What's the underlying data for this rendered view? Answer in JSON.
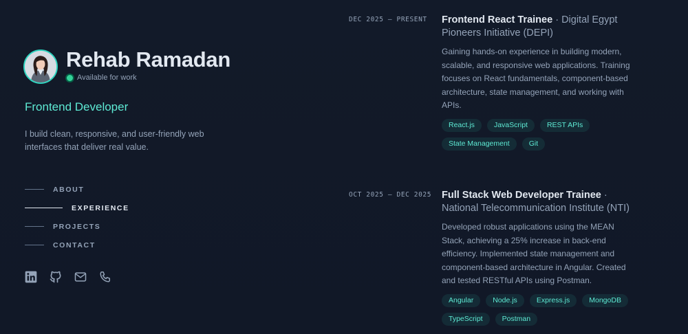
{
  "profile": {
    "name": "Rehab Ramadan",
    "availability": "Available for work",
    "role": "Frontend Developer",
    "tagline": "I build clean, responsive, and user-friendly web interfaces that deliver real value."
  },
  "nav": {
    "items": [
      {
        "label": "ABOUT",
        "active": false
      },
      {
        "label": "EXPERIENCE",
        "active": true
      },
      {
        "label": "PROJECTS",
        "active": false
      },
      {
        "label": "CONTACT",
        "active": false
      }
    ]
  },
  "socials": [
    {
      "icon": "linkedin-icon"
    },
    {
      "icon": "github-icon"
    },
    {
      "icon": "mail-icon"
    },
    {
      "icon": "phone-icon"
    }
  ],
  "experience": [
    {
      "date": "DEC 2025 — PRESENT",
      "title": "Frontend React Trainee",
      "separator": "·",
      "company": "Digital Egypt Pioneers Initiative (DEPI)",
      "description": "Gaining hands-on experience in building modern, scalable, and responsive web applications. Training focuses on React fundamentals, component-based architecture, state management, and working with APIs.",
      "tags": [
        "React.js",
        "JavaScript",
        "REST APIs",
        "State Management",
        "Git"
      ]
    },
    {
      "date": "OCT 2025 — DEC 2025",
      "title": "Full Stack Web Developer Trainee",
      "separator": "·",
      "company": "National Telecommunication Institute (NTI)",
      "description": "Developed robust applications using the MEAN Stack, achieving a 25% increase in back-end efficiency. Implemented state management and component-based architecture in Angular. Created and tested RESTful APIs using Postman.",
      "tags": [
        "Angular",
        "Node.js",
        "Express.js",
        "MongoDB",
        "TypeScript",
        "Postman"
      ]
    }
  ],
  "colors": {
    "background": "#111827",
    "accent": "#5eead4",
    "status": "#34d399",
    "heading": "#e2e8f0",
    "body": "#94a3b8"
  }
}
